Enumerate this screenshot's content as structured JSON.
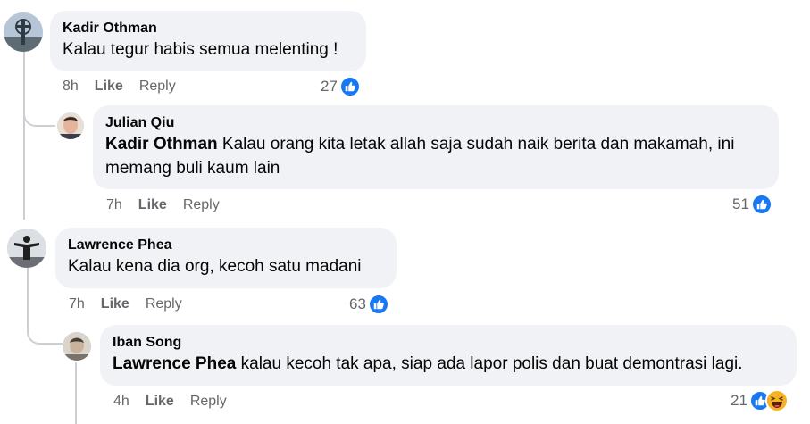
{
  "comments": [
    {
      "author": "Kadir Othman",
      "mention": "",
      "text": "Kalau tegur habis semua melenting !",
      "time": "8h",
      "like_label": "Like",
      "reply_label": "Reply",
      "reaction_count": "27"
    },
    {
      "author": "Julian Qiu",
      "mention": "Kadir Othman",
      "text_line1": " Kalau orang kita letak allah saja sudah naik berita dan makamah, ini",
      "text_line2": "memang buli kaum lain",
      "time": "7h",
      "like_label": "Like",
      "reply_label": "Reply",
      "reaction_count": "51"
    },
    {
      "author": "Lawrence Phea",
      "mention": "",
      "text": "Kalau kena dia org, kecoh satu madani",
      "time": "7h",
      "like_label": "Like",
      "reply_label": "Reply",
      "reaction_count": "63"
    },
    {
      "author": "Iban Song",
      "mention": "Lawrence Phea",
      "text": " kalau kecoh tak apa, siap ada lapor polis dan buat demontrasi lagi.",
      "time": "4h",
      "like_label": "Like",
      "reply_label": "Reply",
      "reaction_count": "21"
    }
  ],
  "colors": {
    "bubble": "#f0f2f5",
    "like_blue": "#1877f2",
    "meta_grey": "#65676b",
    "thread_line": "#ccd0d5"
  }
}
